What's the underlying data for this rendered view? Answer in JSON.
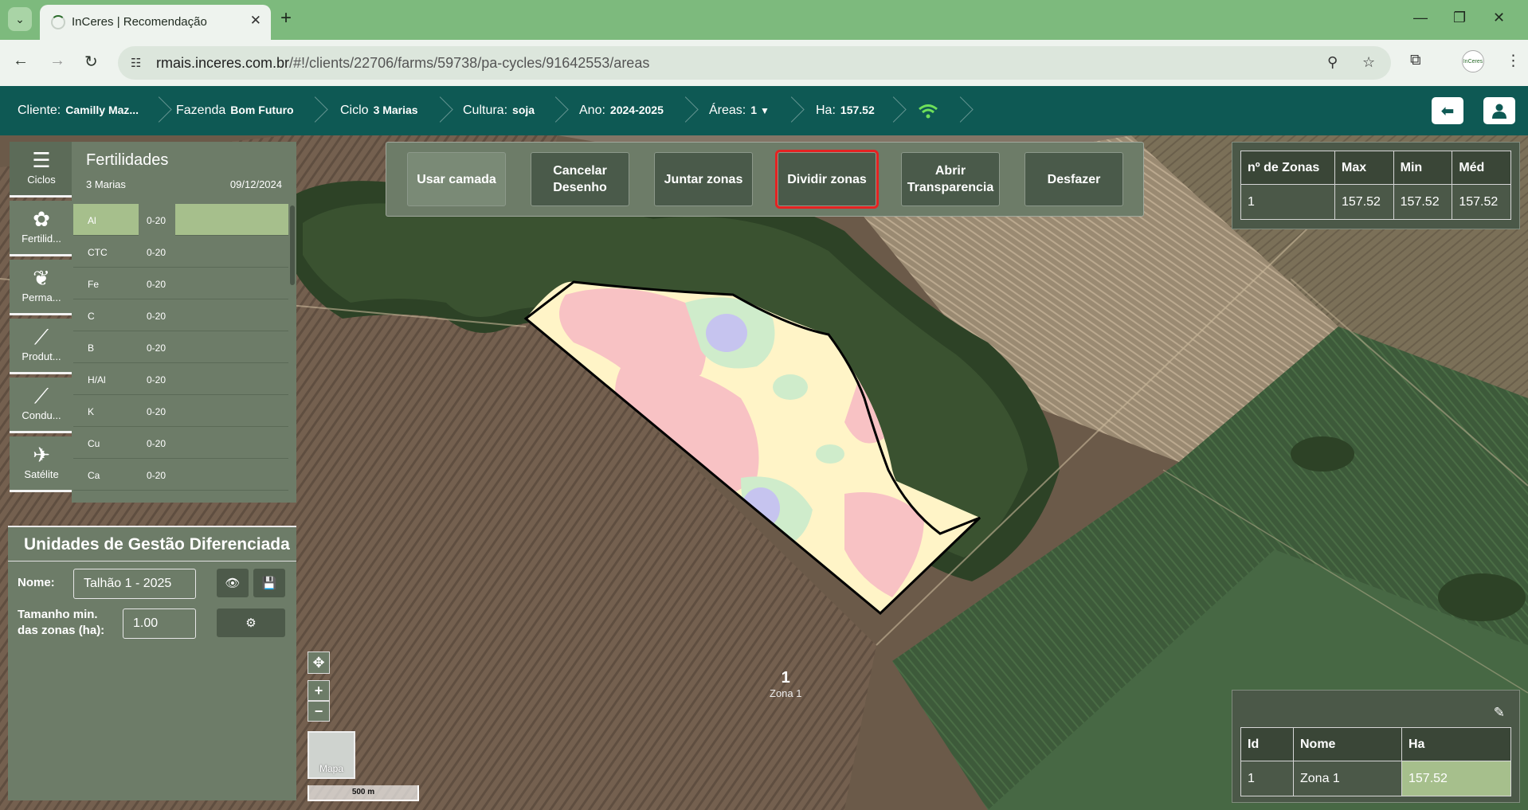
{
  "browser": {
    "tab_title": "InCeres | Recomendação",
    "url_host": "rmais.inceres.com.br",
    "url_path": "/#!/clients/22706/farms/59738/pa-cycles/91642553/areas",
    "profile_text": "InCeres"
  },
  "header": {
    "cliente_label": "Cliente:",
    "cliente_value": "Camilly Maz...",
    "fazenda_label": "Fazenda",
    "fazenda_value": "Bom Futuro",
    "ciclo_label": "Ciclo",
    "ciclo_value": "3 Marias",
    "cultura_label": "Cultura:",
    "cultura_value": "soja",
    "ano_label": "Ano:",
    "ano_value": "2024-2025",
    "areas_label": "Áreas:",
    "areas_value": "1",
    "ha_label": "Ha:",
    "ha_value": "157.52"
  },
  "nav": {
    "items": [
      {
        "label": "Ciclos",
        "icon": "list-icon"
      },
      {
        "label": "Fertilid...",
        "icon": "fertility-icon"
      },
      {
        "label": "Perma...",
        "icon": "plants-icon"
      },
      {
        "label": "Produt...",
        "icon": "chart-icon"
      },
      {
        "label": "Condu...",
        "icon": "chart-icon"
      },
      {
        "label": "Satélite",
        "icon": "satellite-icon"
      }
    ]
  },
  "fertilidades": {
    "title": "Fertilidades",
    "subtitle": "3 Marias",
    "date": "09/12/2024",
    "rows": [
      {
        "name": "Al",
        "depth": "0-20"
      },
      {
        "name": "CTC",
        "depth": "0-20"
      },
      {
        "name": "Fe",
        "depth": "0-20"
      },
      {
        "name": "C",
        "depth": "0-20"
      },
      {
        "name": "B",
        "depth": "0-20"
      },
      {
        "name": "H/Al",
        "depth": "0-20"
      },
      {
        "name": "K",
        "depth": "0-20"
      },
      {
        "name": "Cu",
        "depth": "0-20"
      },
      {
        "name": "Ca",
        "depth": "0-20"
      }
    ]
  },
  "ugd": {
    "title": "Unidades de Gestão Diferenciada",
    "nome_label": "Nome:",
    "nome_value": "Talhão 1 - 2025",
    "tamanho_label_1": "Tamanho min.",
    "tamanho_label_2": "das zonas (ha):",
    "tamanho_value": "1.00"
  },
  "tools": {
    "usar_camada": "Usar camada",
    "cancelar_1": "Cancelar",
    "cancelar_2": "Desenho",
    "juntar": "Juntar zonas",
    "dividir": "Dividir zonas",
    "abrir_1": "Abrir",
    "abrir_2": "Transparencia",
    "desfazer": "Desfazer"
  },
  "stats": {
    "headers": [
      "nº de Zonas",
      "Max",
      "Min",
      "Méd"
    ],
    "row": [
      "1",
      "157.52",
      "157.52",
      "157.52"
    ]
  },
  "zones": {
    "headers": [
      "Id",
      "Nome",
      "Ha"
    ],
    "rows": [
      [
        "1",
        "Zona 1",
        "157.52"
      ]
    ]
  },
  "map": {
    "zone_number": "1",
    "zone_name": "Zona 1",
    "base_layer_label": "Mapa",
    "scale_label": "500 m"
  },
  "colors": {
    "header_bg": "#0e5954",
    "panel_bg": "#6d7c68",
    "highlight": "#a6bf8c",
    "selected_outline": "#e52222"
  }
}
